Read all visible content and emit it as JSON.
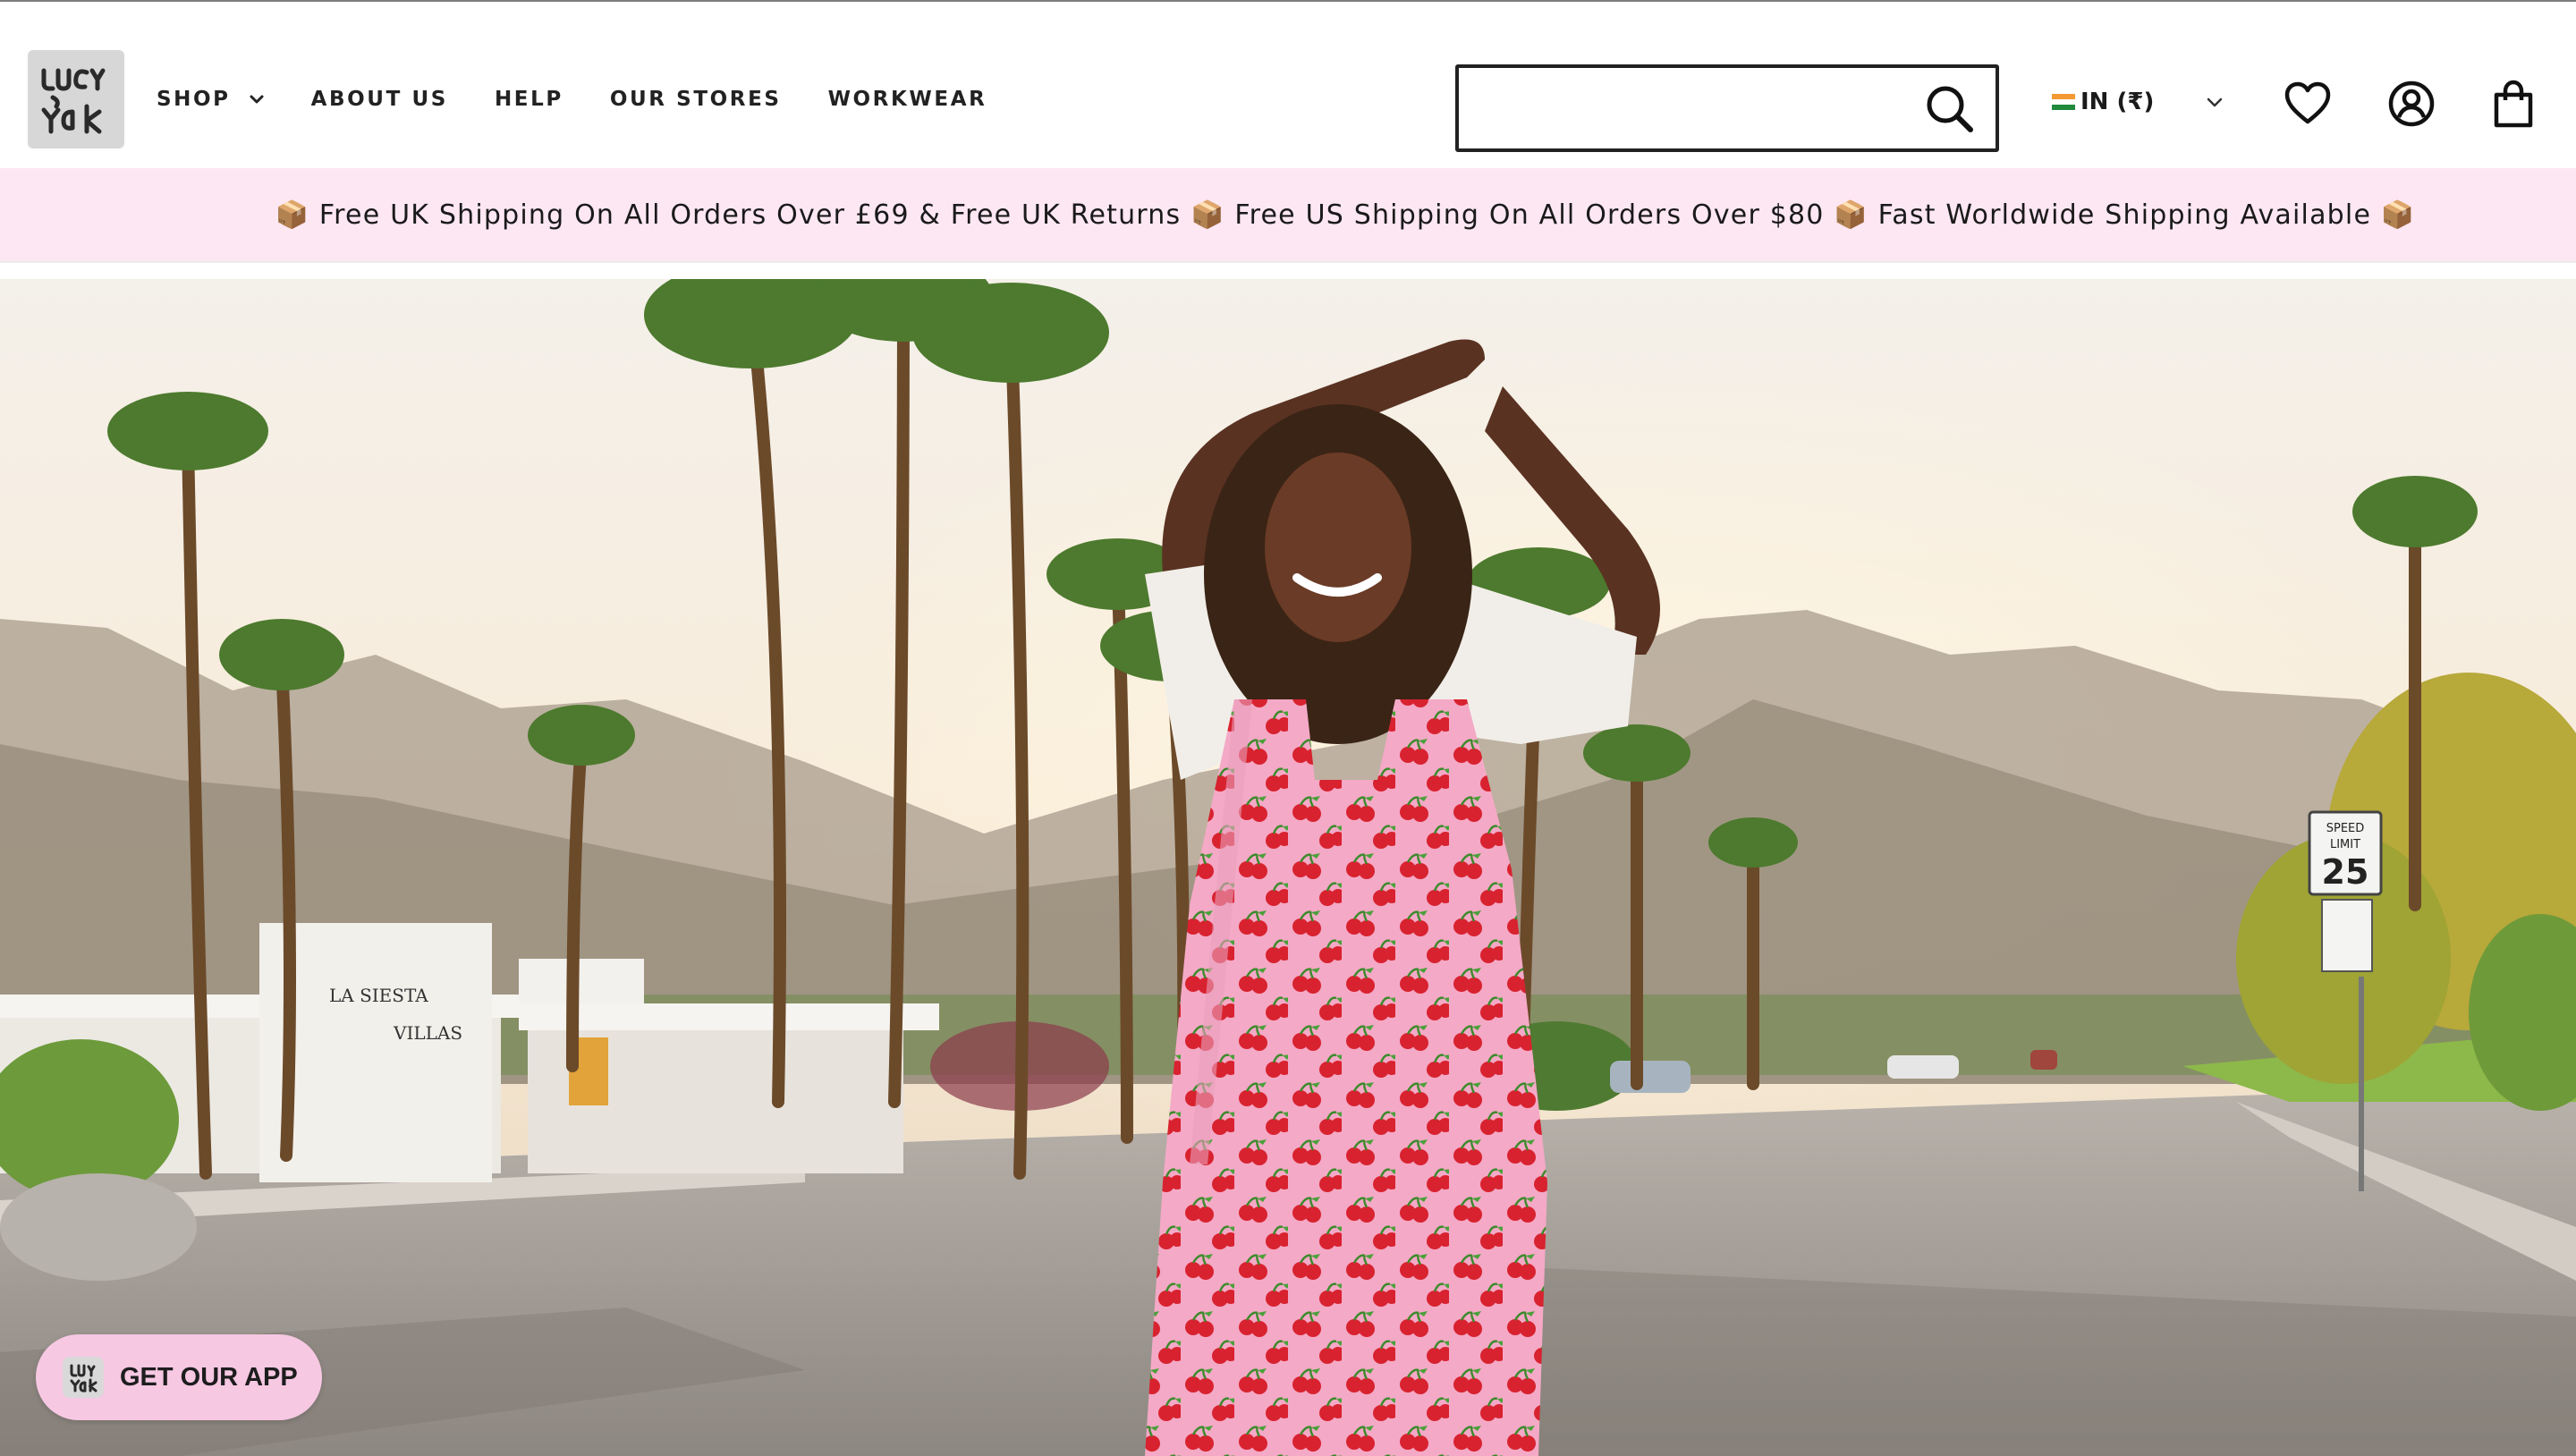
{
  "brand": {
    "name": "Lucy & Yak",
    "logo_text": "Lucy & Yak"
  },
  "nav": {
    "items": [
      {
        "label": "SHOP",
        "has_dropdown": true
      },
      {
        "label": "ABOUT US",
        "has_dropdown": false
      },
      {
        "label": "HELP",
        "has_dropdown": false
      },
      {
        "label": "OUR STORES",
        "has_dropdown": false
      },
      {
        "label": "WORKWEAR",
        "has_dropdown": false
      }
    ]
  },
  "search": {
    "value": "",
    "placeholder": "",
    "icon": "search-icon"
  },
  "currency": {
    "label": "IN (₹)",
    "flag": "india-flag-icon"
  },
  "header_icons": [
    "heart-icon",
    "account-icon",
    "bag-icon"
  ],
  "announcement": {
    "text": "📦 Free UK Shipping On All Orders Over £69 & Free UK Returns 📦 Free US Shipping On All Orders Over $80 📦 Fast Worldwide Shipping Available 📦",
    "background": "#fde7f3"
  },
  "hero": {
    "image": "Model in pink cherry-print dungarees on a palm-lined desert street",
    "sign_text": "LA SIESTA",
    "sign_text_2": "VILLAS",
    "speed_sign_top": "SPEED",
    "speed_sign_mid": "LIMIT",
    "speed_sign_value": "25"
  },
  "app_button": {
    "label": "GET OUR APP",
    "background": "#f6c8e2"
  },
  "colors": {
    "accent_pink": "#fde7f3",
    "text": "#1a1a1a"
  }
}
